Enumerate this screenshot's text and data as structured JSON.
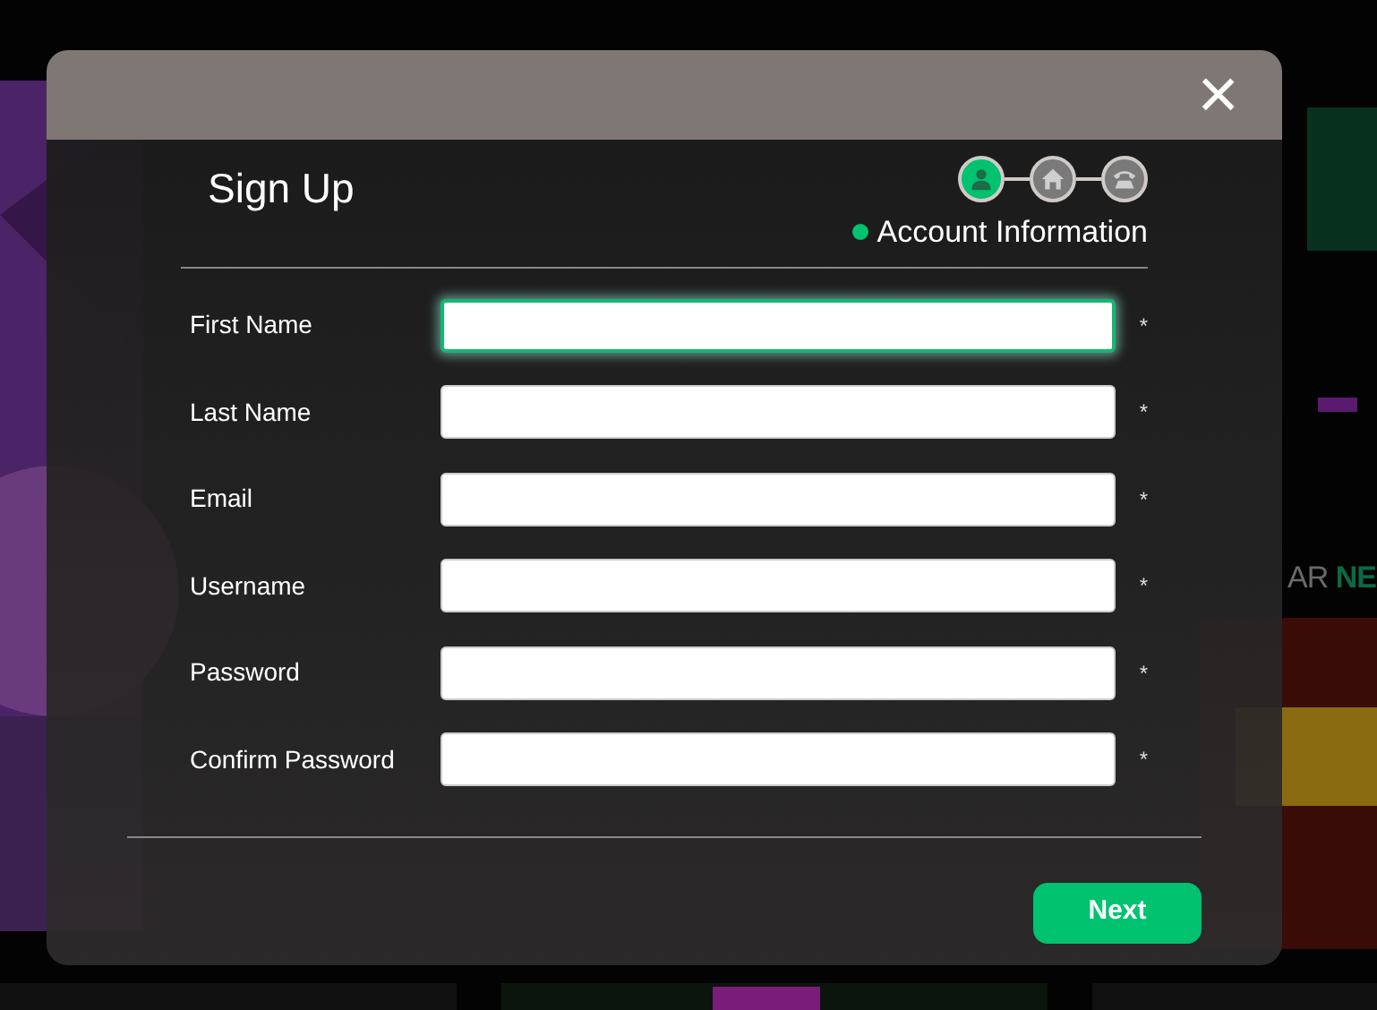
{
  "background": {
    "section_heading": {
      "plain": "AR ",
      "accent": "NE"
    }
  },
  "modal": {
    "close_label": "×",
    "title": "Sign Up",
    "steps": [
      {
        "kind": "person",
        "selected": true
      },
      {
        "kind": "house",
        "selected": false
      },
      {
        "kind": "phone",
        "selected": false
      }
    ],
    "step_label": "Account Information",
    "fields": [
      {
        "label": "First Name",
        "required_mark": "*",
        "focused": true
      },
      {
        "label": "Last Name",
        "required_mark": "*",
        "focused": false
      },
      {
        "label": "Email",
        "required_mark": "*",
        "focused": false
      },
      {
        "label": "Username",
        "required_mark": "*",
        "focused": false
      },
      {
        "label": "Password",
        "required_mark": "*",
        "focused": false
      },
      {
        "label": "Confirm Password",
        "required_mark": "*",
        "focused": false
      }
    ],
    "next_button": "Next"
  }
}
